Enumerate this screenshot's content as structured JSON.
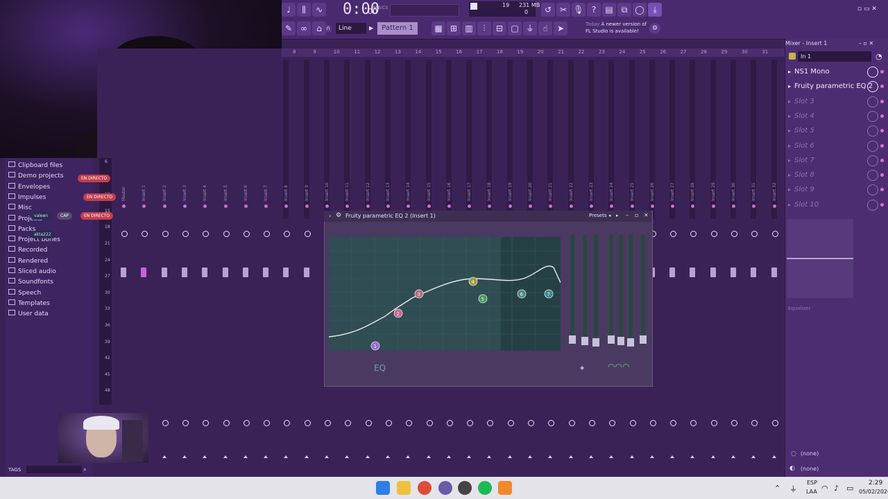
{
  "webcam": {
    "label": ""
  },
  "toolbar": {
    "time": "0:00",
    "time_sub": "00",
    "time_unit": "M:S:CS",
    "cpu": "19",
    "memory": "231 MB",
    "cpu_zero": "0",
    "snap": "Line",
    "pattern": "Pattern 1",
    "hint_today": "Today",
    "hint_text": "A newer version of FL Studio is available!"
  },
  "ruler": [
    "8",
    "9",
    "10",
    "11",
    "12",
    "13",
    "14",
    "15",
    "16",
    "17",
    "18",
    "19",
    "20",
    "21",
    "22",
    "23",
    "24",
    "25",
    "26",
    "27",
    "28",
    "29",
    "30",
    "31"
  ],
  "browser": {
    "items": [
      {
        "label": "Clipboard files"
      },
      {
        "label": "Demo projects"
      },
      {
        "label": "Envelopes"
      },
      {
        "label": "Impulses"
      },
      {
        "label": "Misc"
      },
      {
        "label": "Projects"
      },
      {
        "label": "Packs"
      },
      {
        "label": "Project bones"
      },
      {
        "label": "Recorded"
      },
      {
        "label": "Rendered"
      },
      {
        "label": "Sliced audio"
      },
      {
        "label": "Soundfonts"
      },
      {
        "label": "Speech"
      },
      {
        "label": "Templates"
      },
      {
        "label": "User data"
      }
    ],
    "tags": "TAGS"
  },
  "overlay": {
    "live": "EN DIRECTO",
    "cap": "CAP",
    "user": "akta222",
    "viewer": "valeen"
  },
  "mixer": {
    "inserts": [
      "Master",
      "Insert 1",
      "Insert 2",
      "Insert 3",
      "Insert 4",
      "Insert 5",
      "Insert 6",
      "Insert 7",
      "Insert 8",
      "Insert 9",
      "Insert 10",
      "Insert 11",
      "Insert 12",
      "Insert 13",
      "Insert 14",
      "Insert 15",
      "Insert 16",
      "Insert 17",
      "Insert 18",
      "Insert 19",
      "Insert 20",
      "Insert 21",
      "Insert 22",
      "Insert 23",
      "Insert 24",
      "Insert 25",
      "Insert 26",
      "Insert 27",
      "Insert 28",
      "Insert 29",
      "Insert 30",
      "Insert 31",
      "Insert 32"
    ],
    "scale": [
      "6",
      "9",
      "12",
      "15",
      "18",
      "21",
      "24",
      "27",
      "30",
      "33",
      "36",
      "39",
      "42",
      "45",
      "48"
    ]
  },
  "mixer_panel": {
    "title": "Mixer - Insert 1",
    "input": "In 1",
    "slots": [
      {
        "label": "NS1 Mono",
        "active": true
      },
      {
        "label": "Fruity parametric EQ 2",
        "active": true
      },
      {
        "label": "Slot 3",
        "active": false
      },
      {
        "label": "Slot 4",
        "active": false
      },
      {
        "label": "Slot 5",
        "active": false
      },
      {
        "label": "Slot 6",
        "active": false
      },
      {
        "label": "Slot 7",
        "active": false
      },
      {
        "label": "Slot 8",
        "active": false
      },
      {
        "label": "Slot 9",
        "active": false
      },
      {
        "label": "Slot 10",
        "active": false
      }
    ],
    "eq_label": "Equalizer",
    "out1": "(none)",
    "out2": "(none)"
  },
  "eq_plugin": {
    "title": "Fruity parametric EQ 2 (Insert 1)",
    "presets": "Presets",
    "label": "EQ",
    "bands": [
      {
        "band": 1,
        "color": "#9a6ad0"
      },
      {
        "band": 2,
        "color": "#c86a8a"
      },
      {
        "band": 3,
        "color": "#b07070"
      },
      {
        "band": 4,
        "color": "#9aa040"
      },
      {
        "band": 5,
        "color": "#4a9a5a"
      },
      {
        "band": 6,
        "color": "#4a8a7a"
      },
      {
        "band": 7,
        "color": "#3a8a8a"
      }
    ]
  },
  "taskbar": {
    "lang1": "ESP",
    "lang2": "LAA",
    "time": "2:29",
    "date": "05/02/2026"
  }
}
